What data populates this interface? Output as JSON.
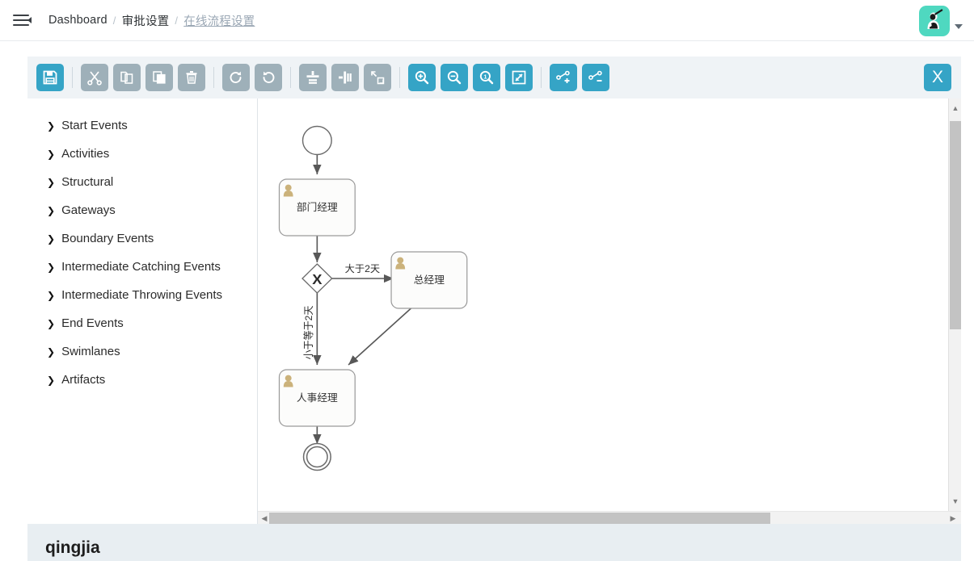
{
  "topbar": {
    "menu_icon": "hamburger-menu-icon",
    "breadcrumb": [
      {
        "label": "Dashboard",
        "muted": false
      },
      {
        "label": "审批设置",
        "muted": false
      },
      {
        "label": "在线流程设置",
        "muted": true
      }
    ],
    "separator": "/",
    "avatar_icon": "user-avatar-icon",
    "avatar_bg": "#4fd8c0",
    "dropdown_icon": "chevron-down-icon"
  },
  "toolbar": {
    "accent_blue": "#35a4c6",
    "inactive_gray": "#9eb0b9",
    "background": "#eff3f6",
    "buttons": [
      {
        "name": "save-button",
        "icon": "save-floppy-icon",
        "state": "blue"
      },
      {
        "name": "cut-button",
        "icon": "scissors-icon",
        "state": "gray"
      },
      {
        "name": "copy-button",
        "icon": "copy-icon",
        "state": "gray"
      },
      {
        "name": "paste-button",
        "icon": "paste-icon",
        "state": "gray"
      },
      {
        "name": "delete-button",
        "icon": "trash-icon",
        "state": "gray"
      },
      {
        "name": "redo-button",
        "icon": "redo-arrow-icon",
        "state": "gray"
      },
      {
        "name": "undo-button",
        "icon": "undo-arrow-icon",
        "state": "gray"
      },
      {
        "name": "align-vertical-button",
        "icon": "align-vertical-icon",
        "state": "gray"
      },
      {
        "name": "align-horizontal-button",
        "icon": "align-horizontal-icon",
        "state": "gray"
      },
      {
        "name": "resize-button",
        "icon": "resize-diagonal-icon",
        "state": "gray"
      },
      {
        "name": "zoom-in-button",
        "icon": "magnifier-plus-icon",
        "state": "blue"
      },
      {
        "name": "zoom-out-button",
        "icon": "magnifier-minus-icon",
        "state": "blue"
      },
      {
        "name": "zoom-actual-button",
        "icon": "magnifier-one-icon",
        "state": "blue"
      },
      {
        "name": "zoom-fit-button",
        "icon": "fit-to-screen-icon",
        "state": "blue"
      },
      {
        "name": "add-edge-button",
        "icon": "edge-plus-icon",
        "state": "blue"
      },
      {
        "name": "remove-edge-button",
        "icon": "edge-minus-icon",
        "state": "blue"
      }
    ],
    "close_label": "X"
  },
  "palette": {
    "arrow_glyph": "❯",
    "items": [
      {
        "label": "Start Events"
      },
      {
        "label": "Activities"
      },
      {
        "label": "Structural"
      },
      {
        "label": "Gateways"
      },
      {
        "label": "Boundary Events"
      },
      {
        "label": "Intermediate Catching Events"
      },
      {
        "label": "Intermediate Throwing Events"
      },
      {
        "label": "End Events"
      },
      {
        "label": "Swimlanes"
      },
      {
        "label": "Artifacts"
      }
    ]
  },
  "diagram": {
    "nodes": {
      "start_event": {
        "type": "start-event",
        "label": ""
      },
      "task_dept": {
        "type": "user-task",
        "label": "部门经理"
      },
      "gateway": {
        "type": "exclusive-gateway",
        "label": "X"
      },
      "task_gm": {
        "type": "user-task",
        "label": "总经理"
      },
      "task_hr": {
        "type": "user-task",
        "label": "人事经理"
      },
      "end_event": {
        "type": "end-event",
        "label": ""
      }
    },
    "edge_labels": {
      "gateway_to_gm": "大于2天",
      "gateway_to_hr": "小于等于2天"
    }
  },
  "scrollbars": {
    "vertical_up_glyph": "▲",
    "vertical_down_glyph": "▼",
    "horizontal_left_glyph": "◀",
    "horizontal_right_glyph": "▶"
  },
  "bottom": {
    "process_name": "qingjia"
  }
}
